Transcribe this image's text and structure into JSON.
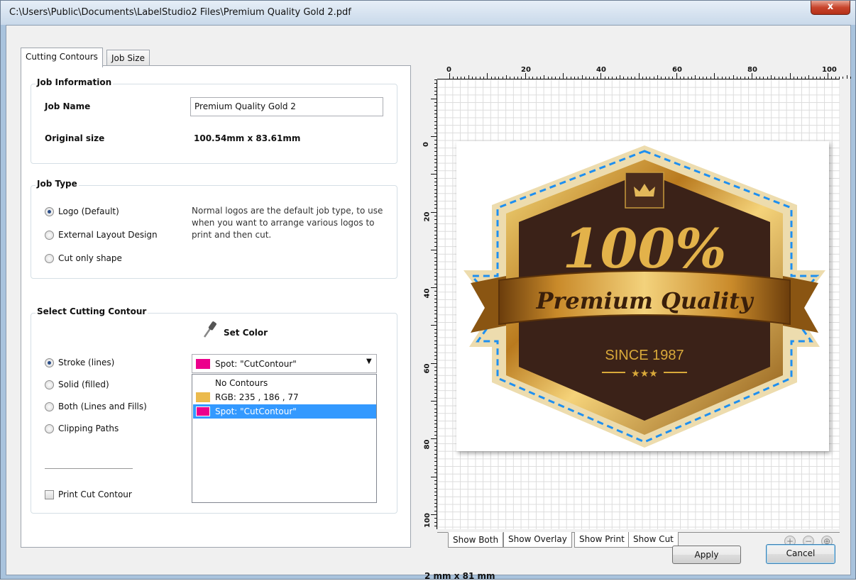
{
  "window": {
    "title": "C:\\Users\\Public\\Documents\\LabelStudio2 Files\\Premium Quality Gold 2.pdf",
    "close_label": "x"
  },
  "tabs": [
    {
      "label": "Cutting Contours",
      "active": true
    },
    {
      "label": "Job Size",
      "active": false
    }
  ],
  "job_information": {
    "group_label": "Job Information",
    "job_name_label": "Job Name",
    "job_name_value": "Premium Quality Gold 2",
    "original_size_label": "Original size",
    "original_size_value": "100.54mm x 83.61mm"
  },
  "job_type": {
    "group_label": "Job Type",
    "options": [
      {
        "label": "Logo (Default)",
        "selected": true
      },
      {
        "label": "External Layout Design",
        "selected": false
      },
      {
        "label": "Cut only shape",
        "selected": false
      }
    ],
    "description": "Normal logos are the default job type, to use when you want to arrange various logos to print and then cut."
  },
  "cutting_contour": {
    "group_label": "Select Cutting Contour",
    "set_color_label": "Set Color",
    "options": [
      {
        "label": "Stroke (lines)",
        "selected": true
      },
      {
        "label": "Solid (filled)",
        "selected": false
      },
      {
        "label": "Both (Lines and Fills)",
        "selected": false
      },
      {
        "label": "Clipping Paths",
        "selected": false
      }
    ],
    "print_cut_contour_label": "Print Cut Contour",
    "print_cut_contour_checked": false,
    "dropdown_value": "Spot: \"CutContour\"",
    "dropdown_swatch": "#ec008c",
    "list_items": [
      {
        "label": "No Contours",
        "swatch": null,
        "selected": false
      },
      {
        "label": "RGB:  235 , 186 , 77",
        "swatch": "#ebba4d",
        "selected": false
      },
      {
        "label": "Spot: \"CutContour\"",
        "swatch": "#ec008c",
        "selected": true
      }
    ]
  },
  "preview": {
    "ruler_top": [
      "0",
      "20",
      "40",
      "60",
      "80",
      "100"
    ],
    "ruler_left": [
      "0",
      "20",
      "40",
      "60",
      "80",
      "100"
    ],
    "badge": {
      "line1": "100%",
      "ribbon": "Premium Quality",
      "since": "SINCE 1987",
      "stars": "★★★"
    },
    "view_tabs": [
      "Show Both",
      "Show Overlay",
      "Show Print",
      "Show Cut"
    ],
    "zoom_in": "+",
    "zoom_out": "−",
    "zoom_fit": "⊕",
    "size_readout": "2 mm x 81 mm"
  },
  "buttons": {
    "apply": "Apply",
    "cancel": "Cancel"
  },
  "colors": {
    "gold": "#d9a93a",
    "dark_brown": "#3b2218",
    "cut_line": "#1e8ff0",
    "selection": "#3399ff"
  }
}
